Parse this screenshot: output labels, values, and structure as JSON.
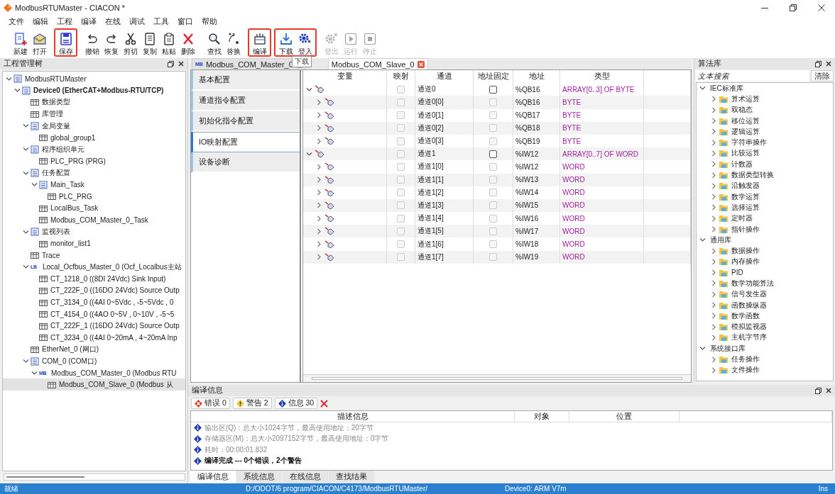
{
  "window": {
    "title": "ModbusRTUMaster - CIACON *"
  },
  "menu": [
    "文件",
    "编辑",
    "工程",
    "编译",
    "在线",
    "调试",
    "工具",
    "窗口",
    "帮助"
  ],
  "toolbar": {
    "tooltip": "下载",
    "groups": [
      {
        "highlighted": false,
        "buttons": [
          {
            "label": "新建",
            "disabled": false
          },
          {
            "label": "打开",
            "disabled": false
          }
        ]
      },
      {
        "highlighted": true,
        "buttons": [
          {
            "label": "保存",
            "disabled": false
          }
        ]
      },
      {
        "highlighted": false,
        "buttons": [
          {
            "label": "撤销",
            "disabled": false
          },
          {
            "label": "恢复",
            "disabled": false
          },
          {
            "label": "剪切",
            "disabled": false
          },
          {
            "label": "复制",
            "disabled": false
          },
          {
            "label": "粘贴",
            "disabled": false
          },
          {
            "label": "删除",
            "disabled": false
          }
        ]
      },
      {
        "highlighted": false,
        "buttons": [
          {
            "label": "查找",
            "disabled": false
          },
          {
            "label": "替换",
            "disabled": false
          }
        ]
      },
      {
        "highlighted": true,
        "buttons": [
          {
            "label": "编译",
            "disabled": false
          }
        ]
      },
      {
        "highlighted": true,
        "buttons": [
          {
            "label": "下载",
            "disabled": false
          },
          {
            "label": "登入",
            "disabled": false
          }
        ]
      },
      {
        "highlighted": false,
        "buttons": [
          {
            "label": "登出",
            "disabled": true
          },
          {
            "label": "运行",
            "disabled": true
          },
          {
            "label": "停止",
            "disabled": true
          }
        ]
      }
    ]
  },
  "project_panel": {
    "title": "工程管理树",
    "tree": [
      {
        "label": "ModbusRTUMaster",
        "expanded": true,
        "selected": false,
        "children": [
          {
            "label": "Device0 (EtherCAT+Modbus-RTU/TCP)",
            "expanded": true,
            "selected": false,
            "children": [
              {
                "label": "数据类型",
                "selected": false
              },
              {
                "label": "库管理",
                "selected": false
              },
              {
                "label": "全局变量",
                "expanded": true,
                "selected": false,
                "children": [
                  {
                    "label": "global_group1",
                    "selected": false
                  }
                ]
              },
              {
                "label": "程序组织单元",
                "expanded": true,
                "selected": false,
                "children": [
                  {
                    "label": "PLC_PRG (PRG)",
                    "selected": false
                  }
                ]
              },
              {
                "label": "任务配置",
                "expanded": true,
                "selected": false,
                "children": [
                  {
                    "label": "Main_Task",
                    "expanded": true,
                    "selected": false,
                    "children": [
                      {
                        "label": "PLC_PRG",
                        "selected": false
                      }
                    ]
                  },
                  {
                    "label": "LocalBus_Task",
                    "selected": false
                  },
                  {
                    "label": "Modbus_COM_Master_0_Task",
                    "selected": false
                  }
                ]
              },
              {
                "label": "监视列表",
                "expanded": true,
                "selected": false,
                "children": [
                  {
                    "label": "monitor_list1",
                    "selected": false
                  }
                ]
              },
              {
                "label": "Trace",
                "selected": false
              },
              {
                "label": "Local_Ocfbus_Master_0 (Ocf_Localbus主站",
                "badge": "LB",
                "expanded": true,
                "selected": false,
                "children": [
                  {
                    "label": "CT_1218_0 ((8DI 24Vdc) Sink Input)",
                    "selected": false
                  },
                  {
                    "label": "CT_222F_0 ((16DO 24Vdc) Source Outp",
                    "selected": false
                  },
                  {
                    "label": "CT_3134_0 ((4AI 0~5Vdc , -5~5Vdc , 0",
                    "selected": false
                  },
                  {
                    "label": "CT_4154_0 ((4AO 0~5V , 0~10V , -5~5",
                    "selected": false
                  },
                  {
                    "label": "CT_222F_1 ((16DO 24Vdc) Source Outp",
                    "selected": false
                  },
                  {
                    "label": "CT_3234_0 ((4AI 0~20mA , 4~20mA Inp",
                    "selected": false
                  }
                ]
              },
              {
                "label": "EtherNet_0 (网口)",
                "selected": false
              },
              {
                "label": "COM_0 (COM口)",
                "expanded": true,
                "selected": false,
                "children": [
                  {
                    "label": "Modbus_COM_Master_0 (Modbus RTU",
                    "badge": "MB",
                    "expanded": true,
                    "selected": false,
                    "children": [
                      {
                        "label": "Modbus_COM_Slave_0 (Modbus 从",
                        "selected": true
                      }
                    ]
                  }
                ]
              }
            ]
          }
        ]
      }
    ]
  },
  "editor": {
    "tabs": [
      {
        "label": "Modbus_COM_Master_0",
        "badge": "MB",
        "selected": false
      },
      {
        "label": "Modbus_COM_Slave_0",
        "selected": true
      }
    ],
    "nav": [
      {
        "label": "基本配置",
        "selected": false
      },
      {
        "label": "通道指令配置",
        "selected": false
      },
      {
        "label": "初始化指令配置",
        "selected": false
      },
      {
        "label": "IO映射配置",
        "selected": true
      },
      {
        "label": "设备诊断",
        "selected": false
      }
    ],
    "columns": [
      "变量",
      "映射",
      "通道",
      "地址固定",
      "地址",
      "类型"
    ],
    "rows": [
      {
        "channel": "通道0",
        "address": "%QB16",
        "type": "ARRAY[0..3] OF BYTE",
        "mapped": false,
        "fixed": false,
        "fixed_disabled": false,
        "expanded": true,
        "children": [
          {
            "channel": "通道0[0]",
            "address": "%QB16",
            "type": "BYTE",
            "mapped": false,
            "fixed": false,
            "fixed_disabled": true,
            "expanded": false
          },
          {
            "channel": "通道0[1]",
            "address": "%QB17",
            "type": "BYTE",
            "mapped": false,
            "fixed": false,
            "fixed_disabled": true,
            "expanded": false
          },
          {
            "channel": "通道0[2]",
            "address": "%QB18",
            "type": "BYTE",
            "mapped": false,
            "fixed": false,
            "fixed_disabled": true,
            "expanded": false
          },
          {
            "channel": "通道0[3]",
            "address": "%QB19",
            "type": "BYTE",
            "mapped": false,
            "fixed": false,
            "fixed_disabled": true,
            "expanded": false
          }
        ]
      },
      {
        "channel": "通道1",
        "address": "%IW12",
        "type": "ARRAY[0..7] OF WORD",
        "mapped": false,
        "fixed": false,
        "fixed_disabled": false,
        "expanded": true,
        "children": [
          {
            "channel": "通道1[0]",
            "address": "%IW12",
            "type": "WORD",
            "mapped": false,
            "fixed": false,
            "fixed_disabled": true,
            "expanded": false
          },
          {
            "channel": "通道1[1]",
            "address": "%IW13",
            "type": "WORD",
            "mapped": false,
            "fixed": false,
            "fixed_disabled": true,
            "expanded": false
          },
          {
            "channel": "通道1[2]",
            "address": "%IW14",
            "type": "WORD",
            "mapped": false,
            "fixed": false,
            "fixed_disabled": true,
            "expanded": false
          },
          {
            "channel": "通道1[3]",
            "address": "%IW15",
            "type": "WORD",
            "mapped": false,
            "fixed": false,
            "fixed_disabled": true,
            "expanded": false
          },
          {
            "channel": "通道1[4]",
            "address": "%IW16",
            "type": "WORD",
            "mapped": false,
            "fixed": false,
            "fixed_disabled": true,
            "expanded": false
          },
          {
            "channel": "通道1[5]",
            "address": "%IW17",
            "type": "WORD",
            "mapped": false,
            "fixed": false,
            "fixed_disabled": true,
            "expanded": false
          },
          {
            "channel": "通道1[6]",
            "address": "%IW18",
            "type": "WORD",
            "mapped": false,
            "fixed": false,
            "fixed_disabled": true,
            "expanded": false
          },
          {
            "channel": "通道1[7]",
            "address": "%IW19",
            "type": "WORD",
            "mapped": false,
            "fixed": false,
            "fixed_disabled": true,
            "expanded": false
          }
        ]
      }
    ]
  },
  "library": {
    "title": "算法库",
    "search": {
      "placeholder": "文本搜索"
    },
    "clear_button": "清除",
    "tree": [
      {
        "label": "IEC标准库",
        "expanded": true,
        "children": [
          {
            "label": "算术运算",
            "expanded": false
          },
          {
            "label": "双稳态",
            "expanded": false
          },
          {
            "label": "移位运算",
            "expanded": false
          },
          {
            "label": "逻辑运算",
            "expanded": false
          },
          {
            "label": "字符串操作",
            "expanded": false
          },
          {
            "label": "比较运算",
            "expanded": false
          },
          {
            "label": "计数器",
            "expanded": false
          },
          {
            "label": "数据类型转换",
            "expanded": false
          },
          {
            "label": "沿触发器",
            "expanded": false
          },
          {
            "label": "数学运算",
            "expanded": false
          },
          {
            "label": "选择运算",
            "expanded": false
          },
          {
            "label": "定时器",
            "expanded": false
          },
          {
            "label": "指针操作",
            "expanded": false
          }
        ]
      },
      {
        "label": "通用库",
        "expanded": true,
        "children": [
          {
            "label": "数据操作",
            "expanded": false
          },
          {
            "label": "内存操作",
            "expanded": false
          },
          {
            "label": "PID",
            "expanded": false
          },
          {
            "label": "数学功能算法",
            "expanded": false
          },
          {
            "label": "信号发生器",
            "expanded": false
          },
          {
            "label": "函数操纵器",
            "expanded": false
          },
          {
            "label": "数学函数",
            "expanded": false
          },
          {
            "label": "模拟监视器",
            "expanded": false
          },
          {
            "label": "主机字节序",
            "expanded": false
          }
        ]
      },
      {
        "label": "系统接口库",
        "expanded": true,
        "children": [
          {
            "label": "任务操作",
            "expanded": false
          },
          {
            "label": "文件操作",
            "expanded": false
          }
        ]
      }
    ]
  },
  "messages": {
    "title": "编译信息",
    "filters": [
      {
        "label": "错误 0",
        "kind": "error"
      },
      {
        "label": "警告 2",
        "kind": "warning"
      },
      {
        "label": "信息 30",
        "kind": "info"
      }
    ],
    "columns": [
      "描述信息",
      "对象",
      "位置"
    ],
    "rows": [
      {
        "text": "输出区(Q)：总大小1024字节，最高使用地址：20字节",
        "kind": "info",
        "emphasis": false
      },
      {
        "text": "存储器区(M)：总大小2097152字节，最高使用地址：0字节",
        "kind": "info",
        "emphasis": false
      },
      {
        "text": "耗时：00:00:01.832",
        "kind": "info",
        "emphasis": false
      },
      {
        "text": "编译完成 --- 0个错误，2个警告",
        "kind": "info",
        "emphasis": true
      }
    ],
    "tabs": [
      {
        "label": "编译信息",
        "selected": true
      },
      {
        "label": "系统信息",
        "selected": false
      },
      {
        "label": "在线信息",
        "selected": false
      },
      {
        "label": "查找结果",
        "selected": false
      }
    ]
  },
  "status_bar": {
    "state": "就绪",
    "path": "D:/ODOT/6 program/CIACON/C4173/ModbusRTUMaster/",
    "device": "Device0: ARM V7m",
    "mode": "Ins"
  }
}
